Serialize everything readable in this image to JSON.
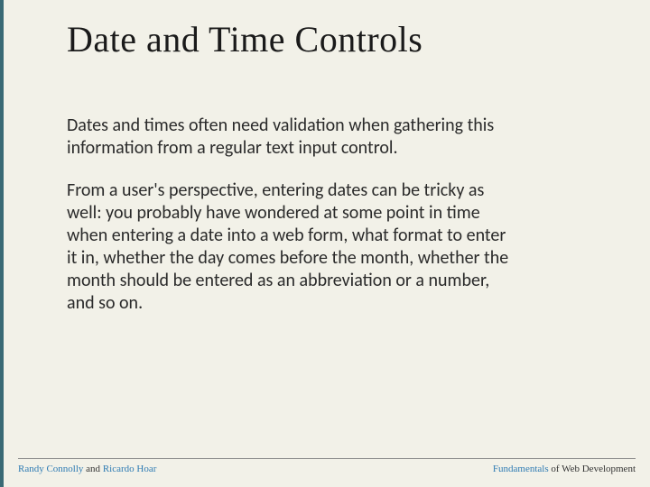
{
  "title": "Date and Time Controls",
  "paragraphs": [
    "Dates and times often need validation when gathering this information from a regular text input control.",
    "From a user's perspective, entering dates can be tricky as well: you probably have wondered at some point in time when entering a date into a web form, what format to enter it in, whether the day comes before the month, whether the month should be entered as an abbreviation or a number, and so on."
  ],
  "footer": {
    "left": {
      "author1": "Randy Connolly",
      "and": " and ",
      "author2": "Ricardo Hoar"
    },
    "right": {
      "linkword": "Fundamentals",
      "rest": " of Web Development"
    }
  }
}
